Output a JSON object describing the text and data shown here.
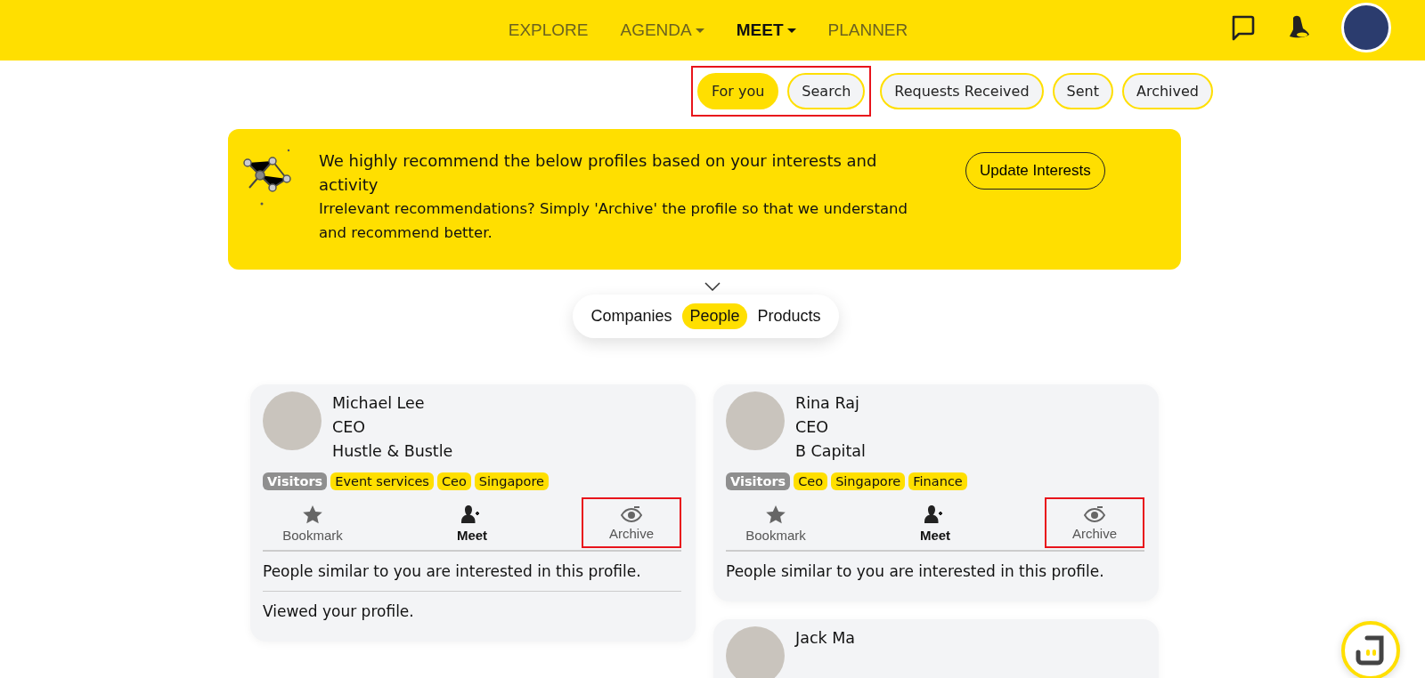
{
  "nav": {
    "items": [
      {
        "label": "EXPLORE",
        "selected": false,
        "dropdown": false
      },
      {
        "label": "AGENDA",
        "selected": false,
        "dropdown": true
      },
      {
        "label": "MEET",
        "selected": true,
        "dropdown": true
      },
      {
        "label": "PLANNER",
        "selected": false,
        "dropdown": false
      }
    ]
  },
  "tabs": [
    {
      "label": "For you",
      "selected": true,
      "highlighted": true
    },
    {
      "label": "Search",
      "selected": false,
      "highlighted": true
    },
    {
      "label": "Requests Received",
      "selected": false,
      "highlighted": false
    },
    {
      "label": "Sent",
      "selected": false,
      "highlighted": false
    },
    {
      "label": "Archived",
      "selected": false,
      "highlighted": false
    }
  ],
  "banner": {
    "heading": "We highly recommend the below profiles based on your interests and activity",
    "text": "Irrelevant recommendations? Simply 'Archive' the profile so that we understand and recommend better.",
    "button": "Update Interests"
  },
  "segments": [
    {
      "label": "Companies",
      "selected": false
    },
    {
      "label": "People",
      "selected": true
    },
    {
      "label": "Products",
      "selected": false
    }
  ],
  "columns": [
    {
      "cards": [
        {
          "name": "Michael Lee",
          "title": "CEO",
          "company": "Hustle & Bustle",
          "tags": [
            {
              "label": "Visitors",
              "kind": "category"
            },
            {
              "label": "Event services",
              "kind": "interest"
            },
            {
              "label": "Ceo",
              "kind": "interest"
            },
            {
              "label": "Singapore",
              "kind": "interest"
            }
          ],
          "actions": [
            {
              "label": "Bookmark",
              "kind": "bookmark",
              "highlighted": false
            },
            {
              "label": "Meet",
              "kind": "meet",
              "highlighted": false
            },
            {
              "label": "Archive",
              "kind": "archive",
              "highlighted": true
            }
          ],
          "notes": [
            "People similar to you are interested in this profile.",
            "Viewed your profile."
          ]
        }
      ]
    },
    {
      "cards": [
        {
          "name": "Rina Raj",
          "title": "CEO",
          "company": "B Capital",
          "tags": [
            {
              "label": "Visitors",
              "kind": "category"
            },
            {
              "label": "Ceo",
              "kind": "interest"
            },
            {
              "label": "Singapore",
              "kind": "interest"
            },
            {
              "label": "Finance",
              "kind": "interest"
            }
          ],
          "actions": [
            {
              "label": "Bookmark",
              "kind": "bookmark",
              "highlighted": false
            },
            {
              "label": "Meet",
              "kind": "meet",
              "highlighted": false
            },
            {
              "label": "Archive",
              "kind": "archive",
              "highlighted": true
            }
          ],
          "notes": [
            "People similar to you are interested in this profile."
          ]
        },
        {
          "name": "Jack Ma"
        }
      ]
    }
  ]
}
